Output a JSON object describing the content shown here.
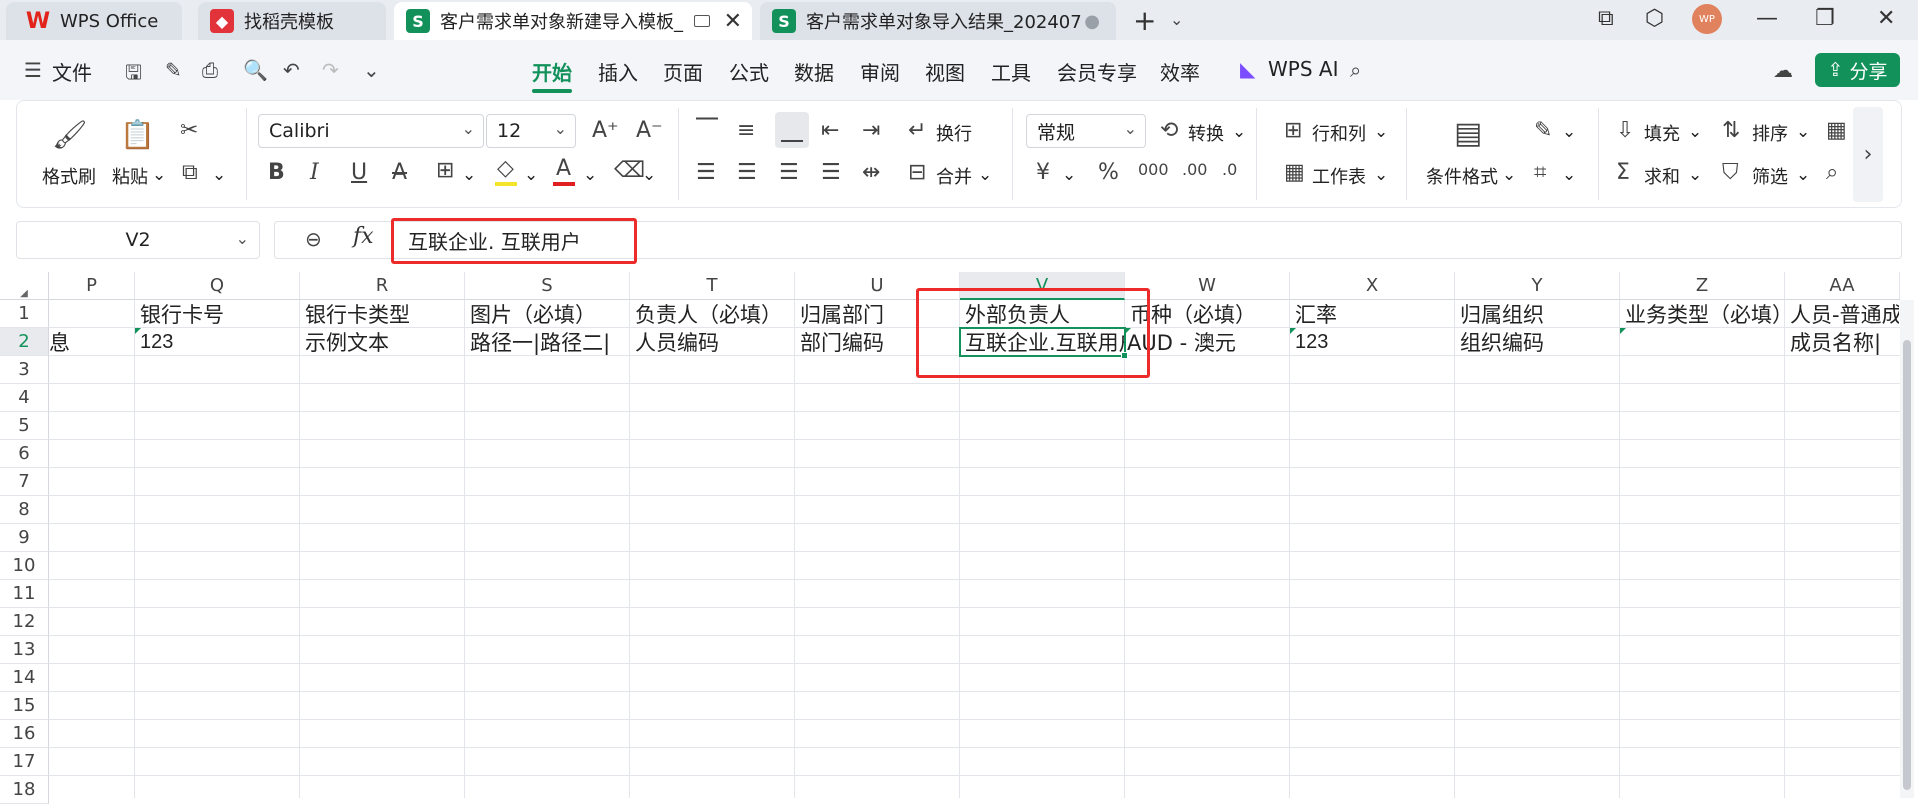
{
  "tabs": [
    {
      "label": "WPS Office"
    },
    {
      "label": "找稻壳模板"
    },
    {
      "label": "客户需求单对象新建导入模板_"
    },
    {
      "label": "客户需求单对象导入结果_202407"
    }
  ],
  "avatar_initials": "WP",
  "menu": {
    "file": "文件",
    "items": [
      "开始",
      "插入",
      "页面",
      "公式",
      "数据",
      "审阅",
      "视图",
      "工具",
      "会员专享",
      "效率"
    ],
    "wps_ai": "WPS AI",
    "share": "分享"
  },
  "ribbon": {
    "format_painter": "格式刷",
    "paste": "粘贴",
    "font_name": "Calibri",
    "font_size": "12",
    "wrap": "换行",
    "merge": "合并",
    "number_format": "常规",
    "convert": "转换",
    "row_col": "行和列",
    "worksheet": "工作表",
    "cond_format": "条件格式",
    "fill": "填充",
    "sort": "排序",
    "sum": "求和",
    "filter": "筛选",
    "font_color": "#e02020",
    "highlight_color": "#f5e52a"
  },
  "formula_bar": {
    "name_box": "V2",
    "fx": "fx",
    "value": "互联企业. 互联用户"
  },
  "grid": {
    "columns": [
      "P",
      "Q",
      "R",
      "S",
      "T",
      "U",
      "V",
      "W",
      "X",
      "Y",
      "Z",
      "AA"
    ],
    "rows": [
      "1",
      "2",
      "3",
      "4",
      "5",
      "6",
      "7",
      "8",
      "9",
      "10",
      "11",
      "12",
      "13",
      "14",
      "15",
      "16",
      "17",
      "18"
    ],
    "row1": [
      "",
      "银行卡号",
      "银行卡类型",
      "图片（必填）",
      "负责人（必填）",
      "归属部门",
      "外部负责人",
      "币种（必填）",
      "汇率",
      "归属组织",
      "业务类型（必填）",
      "人员-普通成"
    ],
    "row2": [
      "息",
      "123",
      "示例文本",
      "路径一|路径二|",
      "人员编码",
      "部门编码",
      "互联企业.互联用户",
      "AUD - 澳元",
      "123",
      "组织编码",
      "",
      "成员名称|"
    ]
  }
}
